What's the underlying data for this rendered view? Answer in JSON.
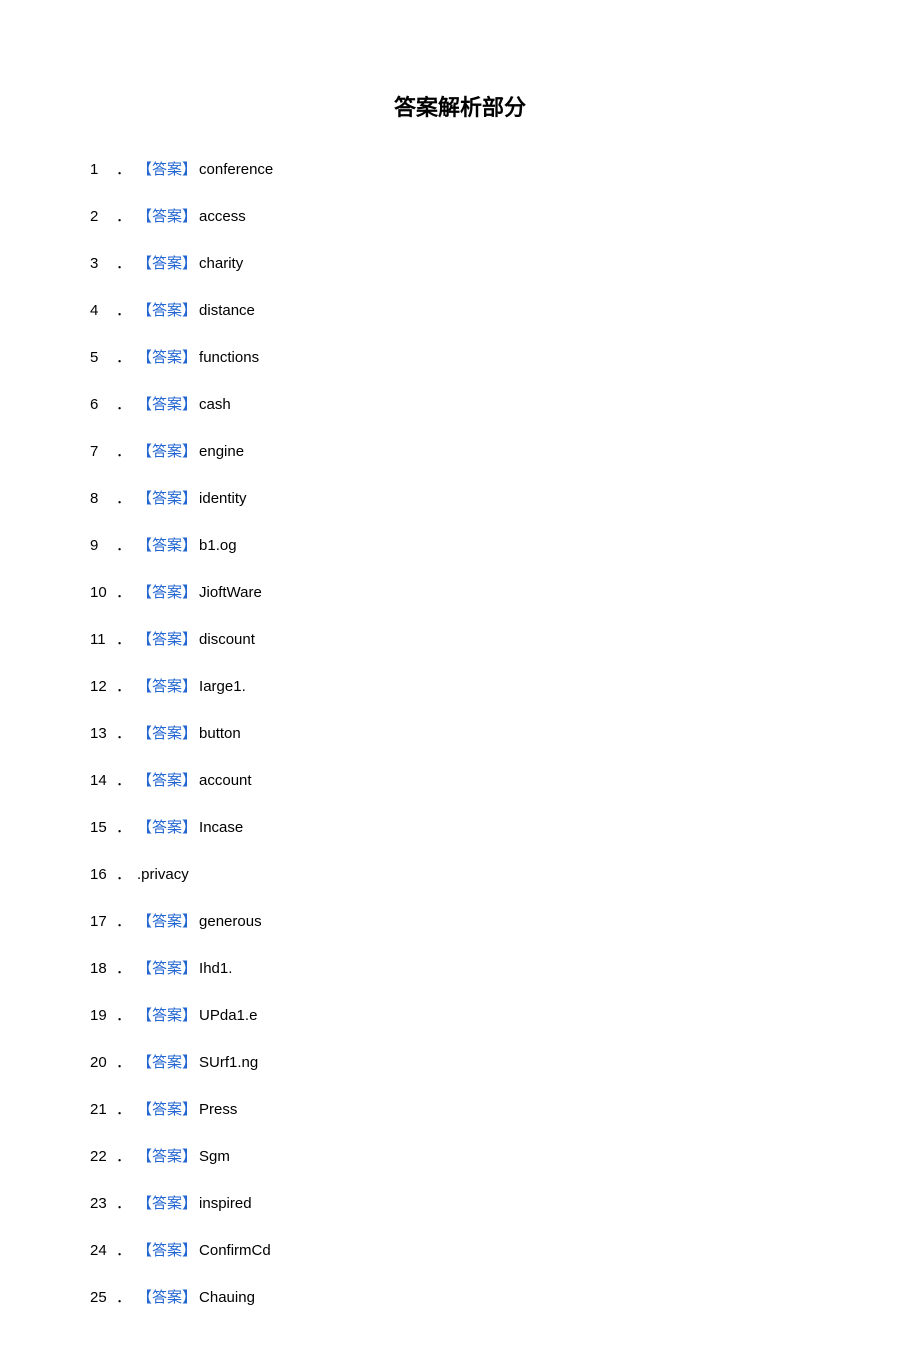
{
  "title": "答案解析部分",
  "tag_text": "【答案】",
  "dot": "．",
  "items": [
    {
      "num": "1",
      "has_tag": true,
      "value": "conference"
    },
    {
      "num": "2",
      "has_tag": true,
      "value": "access"
    },
    {
      "num": "3",
      "has_tag": true,
      "value": "charity"
    },
    {
      "num": "4",
      "has_tag": true,
      "value": "distance"
    },
    {
      "num": "5",
      "has_tag": true,
      "value": "functions"
    },
    {
      "num": "6",
      "has_tag": true,
      "value": "cash"
    },
    {
      "num": "7",
      "has_tag": true,
      "value": "engine"
    },
    {
      "num": "8",
      "has_tag": true,
      "value": "identity"
    },
    {
      "num": "9",
      "has_tag": true,
      "value": "b1.og"
    },
    {
      "num": "10",
      "has_tag": true,
      "value": "JioftWare"
    },
    {
      "num": "11",
      "has_tag": true,
      "value": "discount"
    },
    {
      "num": "12",
      "has_tag": true,
      "value": "Iarge1."
    },
    {
      "num": "13",
      "has_tag": true,
      "value": "button"
    },
    {
      "num": "14",
      "has_tag": true,
      "value": "account"
    },
    {
      "num": "15",
      "has_tag": true,
      "value": "Incase"
    },
    {
      "num": "16",
      "has_tag": false,
      "value": ".privacy"
    },
    {
      "num": "17",
      "has_tag": true,
      "value": "generous"
    },
    {
      "num": "18",
      "has_tag": true,
      "value": "Ihd1."
    },
    {
      "num": "19",
      "has_tag": true,
      "value": "UPda1.e"
    },
    {
      "num": "20",
      "has_tag": true,
      "value": "SUrf1.ng"
    },
    {
      "num": "21",
      "has_tag": true,
      "value": "Press"
    },
    {
      "num": "22",
      "has_tag": true,
      "value": "Sgm"
    },
    {
      "num": "23",
      "has_tag": true,
      "value": "inspired"
    },
    {
      "num": "24",
      "has_tag": true,
      "value": "ConfirmCd"
    },
    {
      "num": "25",
      "has_tag": true,
      "value": "Chauing"
    }
  ]
}
